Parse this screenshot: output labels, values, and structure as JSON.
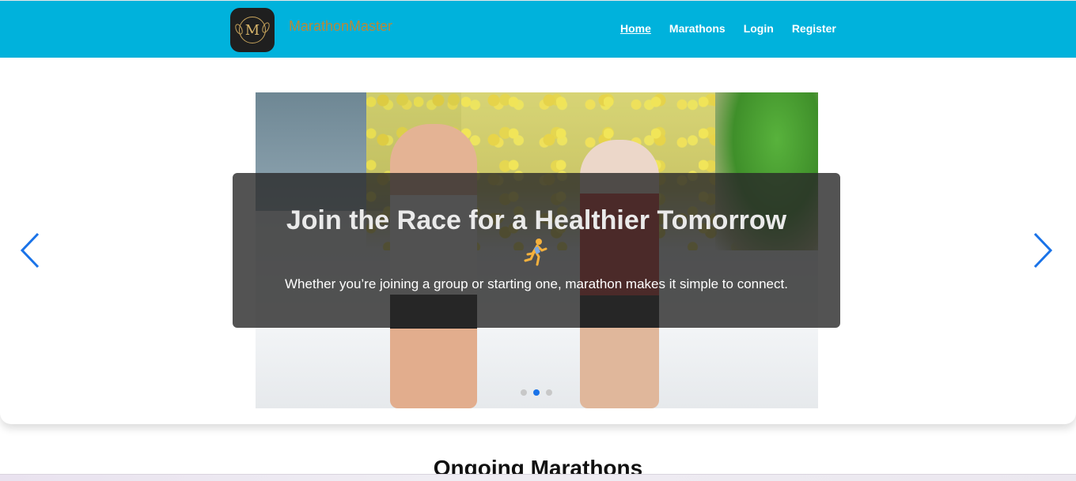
{
  "brand": {
    "name": "MarathonMaster",
    "logo_letter": "M"
  },
  "nav": {
    "items": [
      {
        "label": "Home",
        "active": true
      },
      {
        "label": "Marathons",
        "active": false
      },
      {
        "label": "Login",
        "active": false
      },
      {
        "label": "Register",
        "active": false
      }
    ]
  },
  "hero": {
    "title": "Join the Race for a Healthier Tomorrow",
    "emoji_icon": "person-running-icon",
    "subtitle": "Whether you’re joining a group or starting one, marathon makes it simple to connect.",
    "slide_count": 3,
    "active_slide": 2
  },
  "sections": {
    "ongoing_title": "Ongoing Marathons"
  },
  "colors": {
    "navbar": "#00b2dc",
    "brand_text": "#b8893a",
    "accent": "#1a73e8",
    "caption_bg": "rgba(40,40,40,0.8)"
  }
}
